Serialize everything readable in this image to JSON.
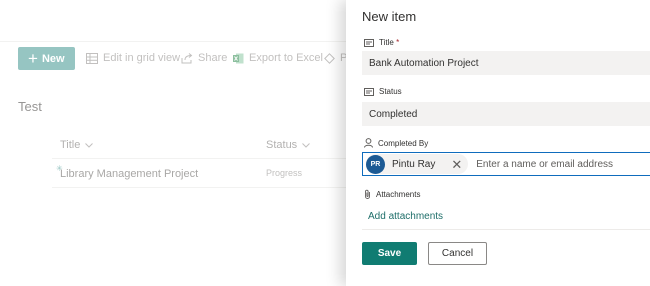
{
  "commandbar": {
    "new_label": "New",
    "edit_grid_label": "Edit in grid view",
    "share_label": "Share",
    "export_label": "Export to Excel",
    "partial_label": "Po"
  },
  "list": {
    "title": "Test",
    "columns": [
      "Title",
      "Status"
    ],
    "rows": [
      {
        "title": "Library Management Project",
        "status": "Progress"
      }
    ]
  },
  "panel": {
    "title": "New item",
    "fields": {
      "title": {
        "label": "Title",
        "required_marker": "*",
        "value": "Bank Automation Project"
      },
      "status": {
        "label": "Status",
        "value": "Completed"
      },
      "completed_by": {
        "label": "Completed By",
        "persona": {
          "initials": "PR",
          "name": "Pintu Ray"
        },
        "placeholder": "Enter a name or email address"
      },
      "attachments": {
        "label": "Attachments",
        "link": "Add attachments"
      }
    },
    "save_label": "Save",
    "cancel_label": "Cancel"
  },
  "colors": {
    "accent": "#107c72",
    "new_button": "#5fa6a2",
    "avatar": "#1c5a94",
    "focus_border": "#0f6cbd",
    "required": "#a4262c"
  },
  "icons": [
    "plus-icon",
    "grid-icon",
    "share-icon",
    "excel-icon",
    "flow-icon",
    "text-field-icon",
    "person-icon",
    "paperclip-icon",
    "close-icon",
    "chevron-down-icon"
  ]
}
